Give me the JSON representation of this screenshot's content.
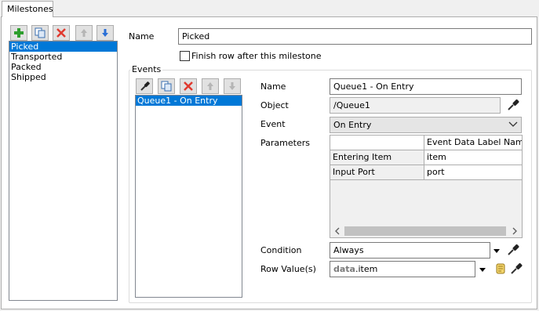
{
  "tab": {
    "label": "Milestones"
  },
  "milestones": {
    "items": [
      "Picked",
      "Transported",
      "Packed",
      "Shipped"
    ],
    "selected_index": 0
  },
  "name": {
    "label": "Name",
    "value": "Picked"
  },
  "finish_row": {
    "label": "Finish row after this milestone",
    "checked": false
  },
  "events": {
    "group_label": "Events",
    "items": [
      "Queue1 - On Entry"
    ],
    "selected_index": 0
  },
  "event_detail": {
    "name_label": "Name",
    "name_value": "Queue1 - On Entry",
    "object_label": "Object",
    "object_value": "/Queue1",
    "event_label": "Event",
    "event_value": "On Entry",
    "parameters_label": "Parameters",
    "table": {
      "column_header": "Event Data Label Name",
      "rows": [
        {
          "label": "Entering Item",
          "value": "item"
        },
        {
          "label": "Input Port",
          "value": "port"
        }
      ]
    },
    "condition_label": "Condition",
    "condition_value": "Always",
    "row_value_label": "Row Value(s)",
    "row_value_keyword": "data",
    "row_value_rest": ".item"
  },
  "colors": {
    "selection": "#0078d7",
    "add_green": "#2e9e2e",
    "delete_red": "#e03a2f",
    "arrow_blue": "#2a6fd6"
  }
}
